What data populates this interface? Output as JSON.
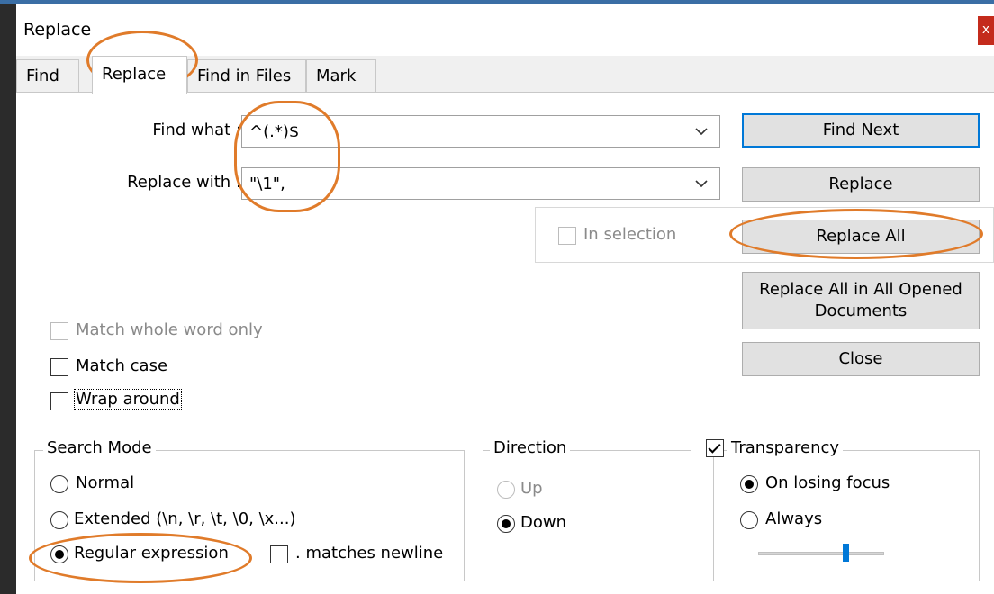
{
  "window": {
    "title": "Replace",
    "close_glyph": "x"
  },
  "tabs": [
    {
      "label": "Find"
    },
    {
      "label": "Replace"
    },
    {
      "label": "Find in Files"
    },
    {
      "label": "Mark"
    }
  ],
  "active_tab": "Replace",
  "find": {
    "label": "Find what :",
    "value": "^(.*)$"
  },
  "replace_field": {
    "label": "Replace with :",
    "value": "\"\\1\","
  },
  "in_selection": {
    "label": "In selection",
    "checked": false,
    "enabled": false
  },
  "buttons": {
    "find_next": "Find Next",
    "replace": "Replace",
    "replace_all": "Replace All",
    "replace_all_opened": "Replace All in All Opened Documents",
    "close": "Close"
  },
  "options": {
    "match_whole_word": {
      "label": "Match whole word only",
      "checked": false,
      "enabled": false
    },
    "match_case": {
      "label": "Match case",
      "checked": false
    },
    "wrap_around": {
      "label": "Wrap around",
      "checked": false
    }
  },
  "search_mode": {
    "legend": "Search Mode",
    "normal": "Normal",
    "extended": "Extended (\\n, \\r, \\t, \\0, \\x...)",
    "regex": "Regular expression",
    "matches_newline": ". matches newline",
    "selected": "regex"
  },
  "direction": {
    "legend": "Direction",
    "up": "Up",
    "down": "Down",
    "selected": "down"
  },
  "transparency": {
    "legend": "Transparency",
    "checked": true,
    "on_losing_focus": "On losing focus",
    "always": "Always",
    "selected": "on_losing_focus",
    "level": 0.68
  },
  "colors": {
    "highlight_ring": "#e07b2a",
    "default_button_border": "#0078d7",
    "close_button": "#c42b1c"
  }
}
